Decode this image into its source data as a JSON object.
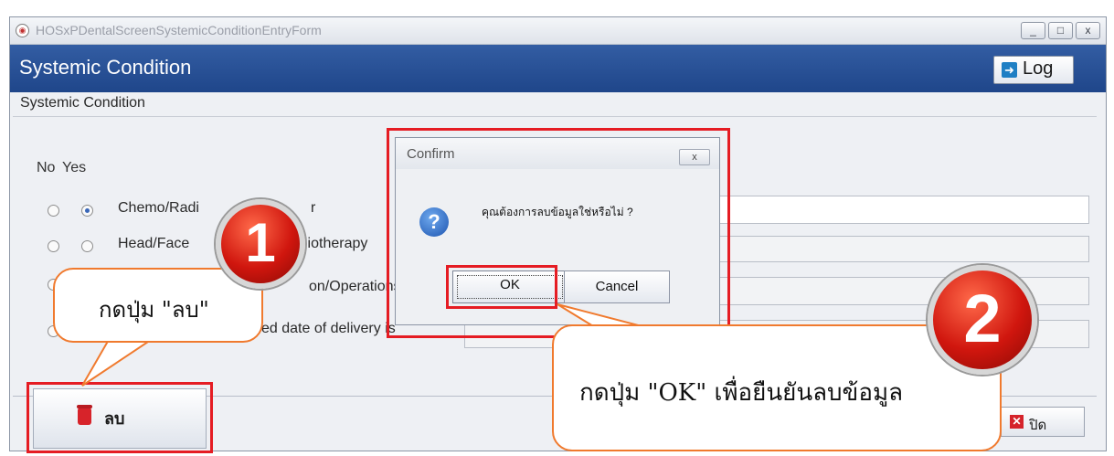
{
  "window": {
    "title": "HOSxPDentalScreenSystemicConditionEntryForm",
    "controls": {
      "minimize": "_",
      "maximize": "□",
      "close": "x"
    }
  },
  "header": {
    "title": "Systemic Condition",
    "log_button": {
      "label": "Log",
      "icon": "log-out-arrow-icon"
    }
  },
  "section": {
    "title": "Systemic Condition",
    "columns": {
      "no": "No",
      "yes": "Yes"
    },
    "rows": [
      {
        "label": "Chemo/Radi",
        "suffix": "r",
        "no": false,
        "yes": true,
        "value": ""
      },
      {
        "label": "Head/Face",
        "suffix": "liotherapy",
        "no": false,
        "yes": false,
        "value": ""
      },
      {
        "label": "",
        "suffix": "on/Operations",
        "no": false,
        "yes": false,
        "value": ""
      },
      {
        "label": "",
        "suffix": "ed date of delivery is",
        "no": false,
        "yes": false,
        "value": ""
      }
    ]
  },
  "footer": {
    "delete_button": {
      "label": "ลบ",
      "icon": "trash-bin-icon"
    },
    "close_button": {
      "label": "ปิด",
      "icon": "close-x-icon"
    }
  },
  "dialog": {
    "title": "Confirm",
    "close": "x",
    "icon": "question-icon",
    "message": "คุณต้องการลบข้อมูลใช่หรือไม่ ?",
    "ok_label": "OK",
    "cancel_label": "Cancel"
  },
  "annotations": {
    "step1_number": "1",
    "step1_text": "กดปุ่ม \"ลบ\"",
    "step2_number": "2",
    "step2_text": "กดปุ่ม \"OK\" เพื่อยืนยันลบข้อมูล",
    "highlight_color": "#e51c23",
    "callout_border_color": "#f07a2e"
  }
}
